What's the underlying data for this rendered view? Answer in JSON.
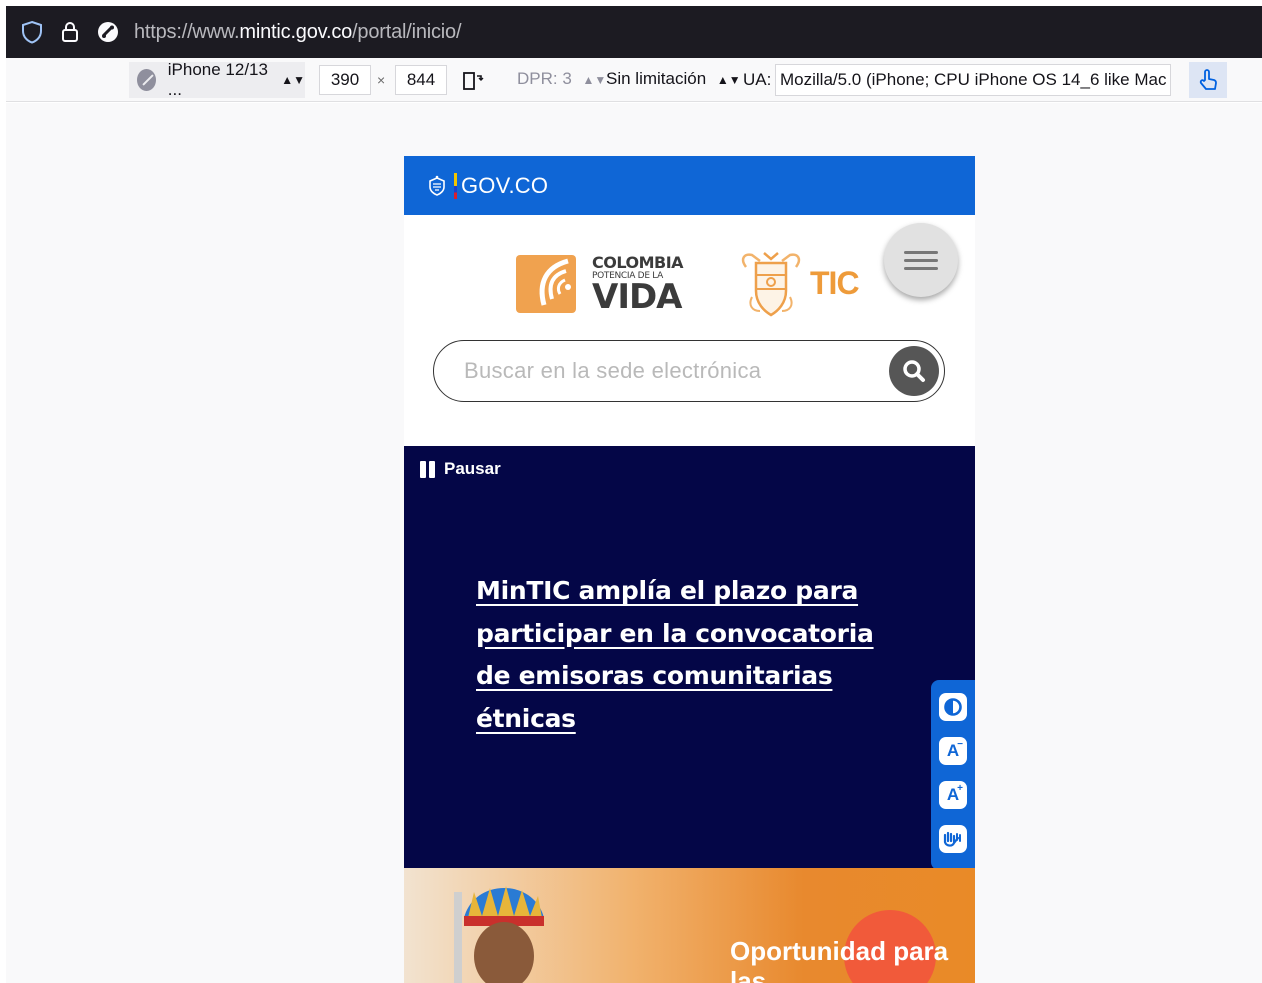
{
  "browser": {
    "url_prefix": "https://www.",
    "url_domain": "mintic.gov.co",
    "url_path": "/portal/inicio/"
  },
  "devtools": {
    "device": "iPhone 12/13 ...",
    "width": "390",
    "times": "×",
    "height": "844",
    "dpr": "DPR: 3",
    "throttling": "Sin limitación",
    "ua_label": "UA:",
    "ua_value": "Mozilla/5.0 (iPhone; CPU iPhone OS 14_6 like Mac"
  },
  "site": {
    "gov_label": "GOV.CO",
    "brand": {
      "line1": "COLOMBIA",
      "line2": "POTENCIA DE LA",
      "line3": "VIDA",
      "tic": "TIC"
    },
    "search_placeholder": "Buscar en la sede electrónica",
    "pause_label": "Pausar",
    "headline": "MinTIC amplía el plazo para participar en la convocatoria de emisoras comunitarias étnicas",
    "banner_text": "Oportunidad para las",
    "accessibility": [
      "contrast-icon",
      "decrease-font-icon",
      "increase-font-icon",
      "sign-language-icon"
    ]
  },
  "colors": {
    "gov_blue": "#0f66d6",
    "hero_navy": "#040647",
    "brand_orange": "#ee9b3a"
  }
}
